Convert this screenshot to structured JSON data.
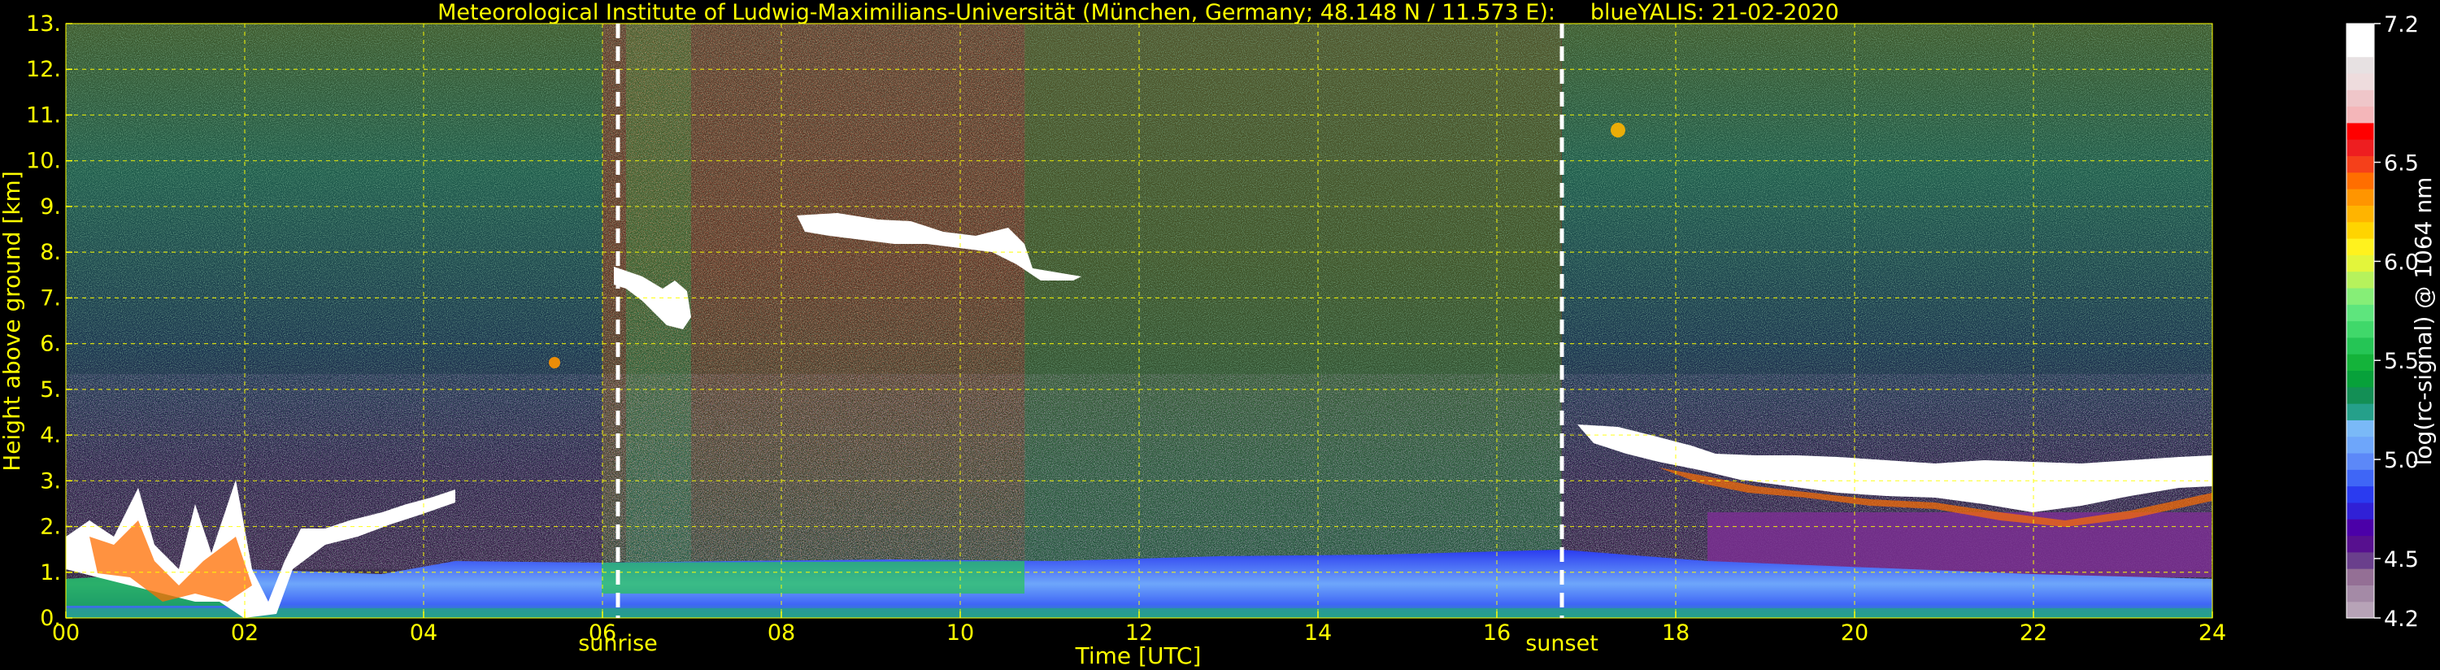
{
  "chart_data": {
    "type": "heatmap",
    "title": "Meteorological Institute of Ludwig-Maximilians-Universität (München, Germany; 48.148 N / 11.573 E):     blueYALIS: 21-02-2020",
    "xlabel": "Time [UTC]",
    "ylabel": "Height above ground [km]",
    "xlim": [
      0,
      24
    ],
    "ylim": [
      0,
      13
    ],
    "x_ticks": [
      "00",
      "02",
      "04",
      "06",
      "08",
      "10",
      "12",
      "14",
      "16",
      "18",
      "20",
      "22",
      "24"
    ],
    "y_ticks": [
      "0.",
      "1.",
      "2.",
      "3.",
      "4.",
      "5.",
      "6.",
      "7.",
      "8.",
      "9.",
      "10.",
      "11.",
      "12.",
      "13."
    ],
    "grid": true,
    "annotations": [
      {
        "label": "sunrise",
        "x": 6.2
      },
      {
        "label": "sunset",
        "x": 16.75
      }
    ],
    "colorbar": {
      "label": "log(rc-signal) @ 1064 nm",
      "range": [
        4.2,
        7.2
      ],
      "ticks": [
        "4.2",
        "4.5",
        "5.0",
        "5.5",
        "6.0",
        "6.5",
        "7.2"
      ],
      "tick_values": [
        4.2,
        4.5,
        5.0,
        5.5,
        6.0,
        6.5,
        7.2
      ],
      "colors": [
        "#b7a3b7",
        "#a48aa6",
        "#946f95",
        "#6a3f8c",
        "#57108f",
        "#4b00a8",
        "#3020d6",
        "#2a3bf0",
        "#3f66f6",
        "#5c88f8",
        "#6ea6fa",
        "#7ab9f7",
        "#25a08a",
        "#138f55",
        "#07a13a",
        "#14b33a",
        "#25c555",
        "#40d86a",
        "#5ee57d",
        "#86ee77",
        "#b6f25c",
        "#e3f53b",
        "#fff21e",
        "#ffd400",
        "#ffb400",
        "#ff9500",
        "#ff6e00",
        "#f5401a",
        "#ee1e20",
        "#ff0000",
        "#f4b6b9",
        "#efc6c9",
        "#eedcdd",
        "#e7e1e2",
        "#ffffff",
        "#ffffff"
      ]
    },
    "features": [
      {
        "type": "boundary_layer",
        "description_values": {
          "x_range": [
            0,
            24
          ],
          "top_km": [
            0.9,
            1.3
          ]
        }
      },
      {
        "type": "cloud",
        "x_range": [
          6.2,
          7.0
        ],
        "height_km": [
          6.3,
          7.6
        ]
      },
      {
        "type": "cloud",
        "x_range": [
          8.2,
          11.1
        ],
        "height_km": [
          7.5,
          8.8
        ]
      },
      {
        "type": "cloud",
        "x_range": [
          16.75,
          24
        ],
        "height_km": [
          2.2,
          4.1
        ]
      },
      {
        "type": "cloud",
        "x_range": [
          0,
          4.3
        ],
        "height_km": [
          0,
          3.5
        ]
      }
    ]
  }
}
